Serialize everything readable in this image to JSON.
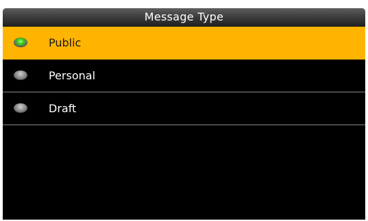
{
  "window": {
    "title": "Message Type"
  },
  "options": [
    {
      "label": "Public",
      "selected": true
    },
    {
      "label": "Personal",
      "selected": false
    },
    {
      "label": "Draft",
      "selected": false
    }
  ],
  "colors": {
    "highlight": "#ffb400",
    "background": "#000000",
    "radio_selected": "#34c41a",
    "radio_unselected": "#8f8f8f"
  },
  "icons": {
    "radio_selected": "radio-selected-icon",
    "radio_unselected": "radio-unselected-icon"
  }
}
